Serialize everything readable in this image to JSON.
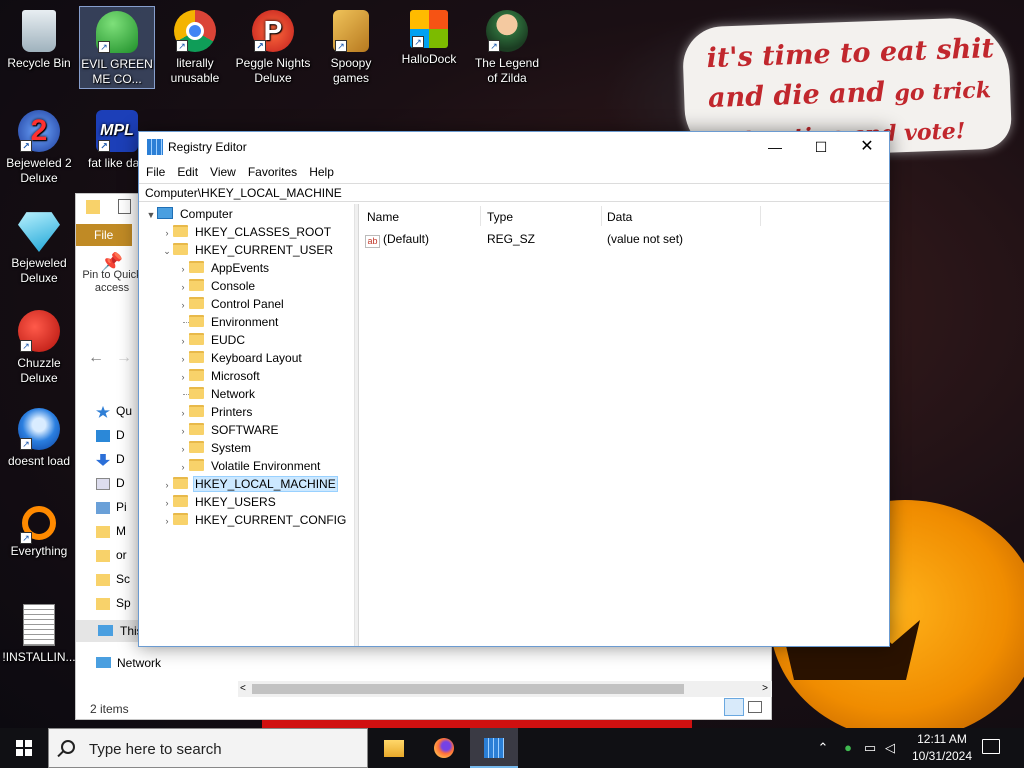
{
  "wallpaper": {
    "sign_line1": "it's time to eat shit",
    "sign_line2a": "and die and",
    "sign_line2b": "go trick",
    "sign_line3": "or treating and vote!"
  },
  "desktop_icons": [
    {
      "label": "Recycle Bin",
      "icon": "recycle-bin-icon"
    },
    {
      "label": "EVIL GREEN ME CO...",
      "icon": "green-people-icon"
    },
    {
      "label": "literally unusable",
      "icon": "chrome-icon"
    },
    {
      "label": "Peggle Nights Deluxe",
      "icon": "peggle-icon"
    },
    {
      "label": "Spoopy games",
      "icon": "folder-games-icon"
    },
    {
      "label": "HalloDock",
      "icon": "windows-logo-icon"
    },
    {
      "label": "The Legend of Zilda",
      "icon": "zilda-icon"
    },
    {
      "label": "Bejeweled 2 Deluxe",
      "icon": "bejeweled2-icon"
    },
    {
      "label": "fat like darl",
      "icon": "mpl-icon"
    },
    {
      "label": "Bejeweled Deluxe",
      "icon": "diamond-icon"
    },
    {
      "label": "Chuzzle Deluxe",
      "icon": "chuzzle-icon"
    },
    {
      "label": "doesnt load",
      "icon": "thunderbird-icon"
    },
    {
      "label": "Everything",
      "icon": "everything-search-icon"
    },
    {
      "label": "!INSTALLIN...",
      "icon": "text-file-icon"
    }
  ],
  "explorer": {
    "file_tab": "File",
    "pin_label": "Pin to Quick access",
    "sidebar": [
      "Qu",
      "D",
      "D",
      "D",
      "Pi",
      "M",
      "or",
      "Sc",
      "Sp",
      "This"
    ],
    "network": "Network",
    "status": "2 items"
  },
  "regedit": {
    "title": "Registry Editor",
    "menu": [
      "File",
      "Edit",
      "View",
      "Favorites",
      "Help"
    ],
    "address": "Computer\\HKEY_LOCAL_MACHINE",
    "tree": {
      "root": "Computer",
      "hives": [
        "HKEY_CLASSES_ROOT",
        "HKEY_CURRENT_USER",
        "HKEY_LOCAL_MACHINE",
        "HKEY_USERS",
        "HKEY_CURRENT_CONFIG"
      ],
      "current_user_children": [
        "AppEvents",
        "Console",
        "Control Panel",
        "Environment",
        "EUDC",
        "Keyboard Layout",
        "Microsoft",
        "Network",
        "Printers",
        "SOFTWARE",
        "System",
        "Volatile Environment"
      ],
      "selected": "HKEY_LOCAL_MACHINE"
    },
    "columns": [
      "Name",
      "Type",
      "Data"
    ],
    "rows": [
      {
        "name": "(Default)",
        "type": "REG_SZ",
        "data": "(value not set)"
      }
    ]
  },
  "taskbar": {
    "search_placeholder": "Type here to search",
    "time": "12:11 AM",
    "date": "10/31/2024",
    "apps": [
      "file-explorer-icon",
      "firefox-icon",
      "registry-editor-icon"
    ]
  }
}
